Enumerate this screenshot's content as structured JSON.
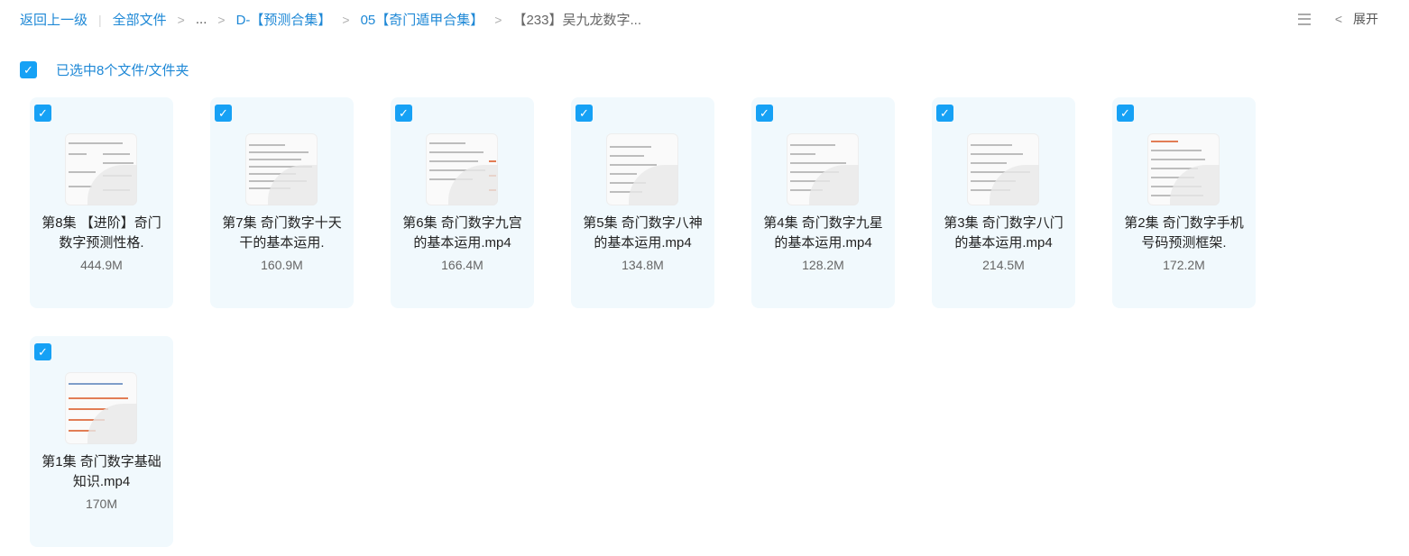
{
  "breadcrumb": {
    "back": "返回上一级",
    "all_files": "全部文件",
    "ellipsis": "...",
    "crumb1": "D-【预测合集】",
    "crumb2": "05【奇门遁甲合集】",
    "current": "【233】吴九龙数字..."
  },
  "toolbar": {
    "expand_label": "展开"
  },
  "selection": {
    "text": "已选中8个文件/文件夹",
    "checked": true
  },
  "files": [
    {
      "name": "第8集 【进阶】奇门数字预测性格.",
      "size": "444.9M",
      "checked": true
    },
    {
      "name": "第7集 奇门数字十天干的基本运用.",
      "size": "160.9M",
      "checked": true
    },
    {
      "name": "第6集 奇门数字九宫的基本运用.mp4",
      "size": "166.4M",
      "checked": true
    },
    {
      "name": "第5集 奇门数字八神的基本运用.mp4",
      "size": "134.8M",
      "checked": true
    },
    {
      "name": "第4集 奇门数字九星的基本运用.mp4",
      "size": "128.2M",
      "checked": true
    },
    {
      "name": "第3集 奇门数字八门的基本运用.mp4",
      "size": "214.5M",
      "checked": true
    },
    {
      "name": "第2集 奇门数字手机号码预测框架.",
      "size": "172.2M",
      "checked": true
    },
    {
      "name": "第1集 奇门数字基础知识.mp4",
      "size": "170M",
      "checked": true
    }
  ],
  "colors": {
    "accent": "#16a1f5",
    "link": "#1e88d6",
    "card_bg": "#f1f9fd"
  }
}
